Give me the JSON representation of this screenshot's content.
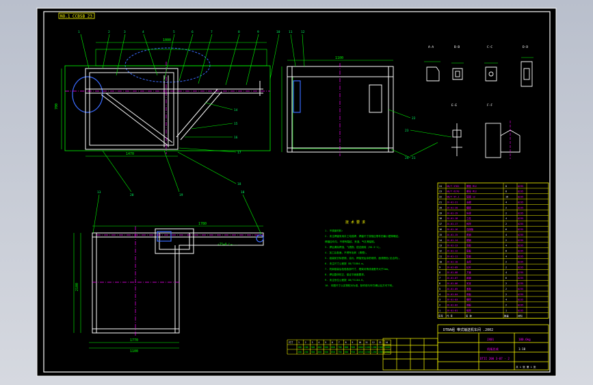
{
  "drawing": {
    "corner_tag": "NO.1  CCBSB 23",
    "balloons": [
      "1",
      "2",
      "3",
      "4",
      "5",
      "6",
      "7",
      "8",
      "9",
      "10",
      "11",
      "12",
      "13",
      "14",
      "15",
      "16",
      "17",
      "18",
      "19",
      "20",
      "21",
      "22",
      "23",
      "24"
    ],
    "section_labels": [
      "A-A",
      "B-B",
      "C-C",
      "D-D",
      "E-E",
      "F-F"
    ],
    "dims": {
      "top_overall": "1000",
      "front_width": "1470",
      "side_width": "1100",
      "plan_width": "1770",
      "plan_mid": "1780",
      "plan_left_height": "2100",
      "plan_lower": "1100",
      "angle_note": "∠75×8 L=...",
      "side_height": "700"
    },
    "notes": {
      "title": "技 术 要 求",
      "lines": [
        "1. 不锈钢材料:",
        "2. 未注焊缝采用手工电弧焊，焊缝尺寸按相应零件的最小壁厚确定。",
        "   焊缝应均匀，不得有裂纹、夹渣、气孔等缺陷。",
        "3. 焊后清除焊渣、飞溅物，锐边倒钝 (R0.5~1)。",
        "4. 加工后各面，不得有毛刺 (清理)。",
        "5. 组装前去除铁锈、油污，焊接完后涂防锈漆，面漆颜色(见合同)。",
        "6. 未注尺寸公差按 GB/T1804-m。",
        "7. 机架组装后检验各部尺寸，框架对角线误差不大于2mm。",
        "8. 焊后整体校正，保证平面度要求。",
        "9. 未注形位公差按 GB/T1184-K。",
        "10. 本图尺寸以实物校对为准，制作前与甲方确认后方可下料。"
      ]
    }
  },
  "bom_rows": [
    [
      "24",
      "GB/T 5782",
      "螺栓 M12",
      "8",
      "Q235"
    ],
    [
      "23",
      "GB/T 6170",
      "螺母 M12",
      "8",
      "Q235"
    ],
    [
      "22",
      "GB/T 97.1",
      "垫圈 12",
      "16",
      "Q235"
    ],
    [
      "21",
      "JX-01-21",
      "支腿",
      "4",
      "Q235"
    ],
    [
      "20",
      "JX-01-20",
      "横梁",
      "2",
      "Q235"
    ],
    [
      "19",
      "JX-01-19",
      "纵梁",
      "2",
      "Q235"
    ],
    [
      "18",
      "JX-01-18",
      "立柱",
      "4",
      "Q235"
    ],
    [
      "17",
      "JX-01-17",
      "斜撑",
      "2",
      "Q235"
    ],
    [
      "16",
      "JX-01-16",
      "连接板",
      "6",
      "Q235"
    ],
    [
      "15",
      "JX-01-15",
      "角钢",
      "4",
      "Q235"
    ],
    [
      "14",
      "JX-01-14",
      "槽钢",
      "2",
      "Q235"
    ],
    [
      "13",
      "JX-01-13",
      "底板",
      "4",
      "Q235"
    ],
    [
      "12",
      "JX-01-12",
      "筋板",
      "8",
      "Q235"
    ],
    [
      "11",
      "JX-01-11",
      "垫板",
      "4",
      "Q235"
    ],
    [
      "10",
      "JX-01-10",
      "支撑",
      "2",
      "Q235"
    ],
    [
      "9",
      "JX-01-09",
      "拉杆",
      "2",
      "Q235"
    ],
    [
      "8",
      "JX-01-08",
      "方管",
      "4",
      "Q235"
    ],
    [
      "7",
      "JX-01-07",
      "扁钢",
      "6",
      "Q235"
    ],
    [
      "6",
      "JX-01-06",
      "吊耳",
      "2",
      "Q235"
    ],
    [
      "5",
      "JX-01-05",
      "盖板",
      "2",
      "Q235"
    ],
    [
      "4",
      "JX-01-04",
      "侧板",
      "2",
      "Q235"
    ],
    [
      "3",
      "JX-01-03",
      "横撑",
      "4",
      "Q235"
    ],
    [
      "2",
      "JX-01-02",
      "端板",
      "2",
      "Q235"
    ],
    [
      "1",
      "JX-01-01",
      "框架",
      "1",
      "Q235"
    ]
  ],
  "bom_header": [
    "序号",
    "代 号",
    "名 称",
    "数量",
    "材料"
  ],
  "title_block": {
    "school": "DTBA组 带式输送机车间 .2002",
    "part_no": "JX01",
    "name": "机架总成",
    "scale": "1:10",
    "weight": "100.6kg",
    "sheet": "共 1 张  第 1 张",
    "drawing_no": "DTII 200 3-07 - 2"
  },
  "bottom_table": {
    "label": "尺寸",
    "header": [
      "1",
      "2",
      "3",
      "4",
      "5",
      "6",
      "7",
      "8",
      "9",
      "10",
      "11",
      "12",
      "13",
      "14"
    ],
    "row1": [
      "100",
      "200",
      "300",
      "400",
      "500",
      "600",
      "700",
      "800",
      "900",
      "1000",
      "1100",
      "1200",
      "1300",
      "1400"
    ],
    "row2": [
      "150",
      "250",
      "350",
      "450",
      "550",
      "650",
      "750",
      "850",
      "950",
      "1050",
      "1150",
      "1250",
      "1350",
      "1450"
    ]
  },
  "colors": {
    "sheet_bg": "#000000",
    "frame": "#ffffff",
    "geometry": "#ffffff",
    "dim": "#00ff00",
    "hidden": "#ff00ff",
    "highlight": "#3a6bff",
    "table": "#ffff00",
    "bom_text": "#ff00ff",
    "balloon_text": "#00ff66"
  }
}
